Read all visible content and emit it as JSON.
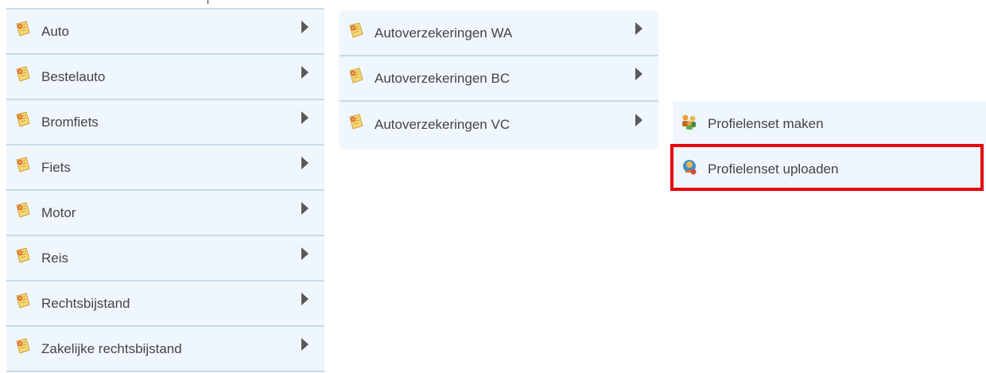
{
  "menu_level1": {
    "items": [
      {
        "label": "Auto",
        "icon": "insurance-doc-icon"
      },
      {
        "label": "Bestelauto",
        "icon": "insurance-doc-icon"
      },
      {
        "label": "Bromfiets",
        "icon": "insurance-doc-icon"
      },
      {
        "label": "Fiets",
        "icon": "insurance-doc-icon"
      },
      {
        "label": "Motor",
        "icon": "insurance-doc-icon"
      },
      {
        "label": "Reis",
        "icon": "insurance-doc-icon"
      },
      {
        "label": "Rechtsbijstand",
        "icon": "insurance-doc-icon"
      },
      {
        "label": "Zakelijke rechtsbijstand",
        "icon": "insurance-doc-icon"
      }
    ]
  },
  "menu_level2": {
    "items": [
      {
        "label": "Autoverzekeringen WA",
        "icon": "insurance-doc-icon"
      },
      {
        "label": "Autoverzekeringen BC",
        "icon": "insurance-doc-icon"
      },
      {
        "label": "Autoverzekeringen VC",
        "icon": "insurance-doc-icon"
      }
    ]
  },
  "menu_level3": {
    "items": [
      {
        "label": "Profielenset maken",
        "icon": "profile-group-icon"
      },
      {
        "label": "Profielenset uploaden",
        "icon": "profile-upload-icon"
      }
    ]
  },
  "colors": {
    "menu_background": "#f0f6fd",
    "divider": "#c7dbe9",
    "highlight_border": "#e8000b",
    "text": "#444444"
  }
}
